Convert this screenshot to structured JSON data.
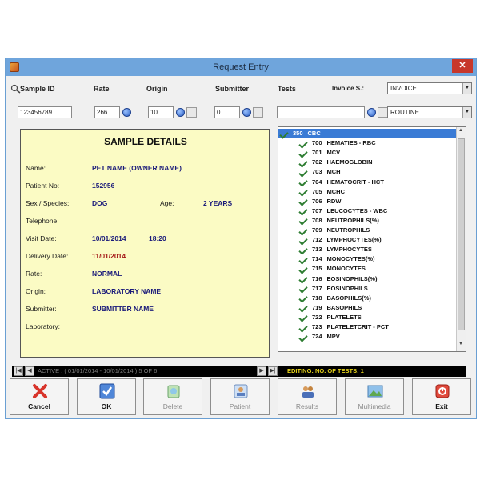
{
  "window": {
    "title": "Request Entry"
  },
  "header": {
    "sample_id_label": "Sample ID",
    "rate_label": "Rate",
    "origin_label": "Origin",
    "submitter_label": "Submitter",
    "tests_label": "Tests",
    "invoice_label": "Invoice S.:",
    "invoice_value": "INVOICE"
  },
  "inputs": {
    "sample_id": "123456789",
    "rate": "266",
    "origin": "10",
    "submitter": "0",
    "tests": "",
    "priority": "ROUTINE"
  },
  "details": {
    "heading": "SAMPLE DETAILS",
    "name_label": "Name:",
    "name": "PET NAME (OWNER NAME)",
    "patient_no_label": "Patient No:",
    "patient_no": "152956",
    "sex_species_label": "Sex / Species:",
    "sex_species": "DOG",
    "age_label": "Age:",
    "age": "2 YEARS",
    "telephone_label": "Telephone:",
    "visit_date_label": "Visit Date:",
    "visit_date": "10/01/2014",
    "visit_time": "18:20",
    "delivery_date_label": "Delivery Date:",
    "delivery_date": "11/01/2014",
    "rate_label": "Rate:",
    "rate": "NORMAL",
    "origin_label": "Origin:",
    "origin": "LABORATORY NAME",
    "submitter_label": "Submitter:",
    "submitter": "SUBMITTER NAME",
    "laboratory_label": "Laboratory:"
  },
  "tests": [
    {
      "code": "350",
      "name": "CBC",
      "selected": true
    },
    {
      "code": "700",
      "name": "HEMATIES - RBC"
    },
    {
      "code": "701",
      "name": "MCV"
    },
    {
      "code": "702",
      "name": "HAEMOGLOBIN"
    },
    {
      "code": "703",
      "name": "MCH"
    },
    {
      "code": "704",
      "name": "HEMATOCRIT - HCT"
    },
    {
      "code": "705",
      "name": "MCHC"
    },
    {
      "code": "706",
      "name": "RDW"
    },
    {
      "code": "707",
      "name": "LEUCOCYTES - WBC"
    },
    {
      "code": "708",
      "name": "NEUTROPHILS(%)"
    },
    {
      "code": "709",
      "name": "NEUTROPHILS"
    },
    {
      "code": "712",
      "name": "LYMPHOCYTES(%)"
    },
    {
      "code": "713",
      "name": "LYMPHOCYTES"
    },
    {
      "code": "714",
      "name": "MONOCYTES(%)"
    },
    {
      "code": "715",
      "name": "MONOCYTES"
    },
    {
      "code": "716",
      "name": "EOSINOPHILS(%)"
    },
    {
      "code": "717",
      "name": "EOSINOPHILS"
    },
    {
      "code": "718",
      "name": "BASOPHILS(%)"
    },
    {
      "code": "719",
      "name": "BASOPHILS"
    },
    {
      "code": "722",
      "name": "PLATELETS"
    },
    {
      "code": "723",
      "name": "PLATELETCRIT - PCT"
    },
    {
      "code": "724",
      "name": "MPV"
    }
  ],
  "status": {
    "active": "ACTIVE : ( 01/01/2014 - 10/01/2014 )  5  OF  6",
    "editing": "EDITING:   NO. OF TESTS:  1"
  },
  "toolbar": {
    "cancel": "Cancel",
    "ok": "OK",
    "delete": "Delete",
    "patient": "Patient",
    "results": "Results",
    "multimedia": "Multimedia",
    "exit": "Exit"
  },
  "colors": {
    "titlebar": "#6fa5dc",
    "details_bg": "#fbfbc4",
    "selected_row": "#3a7bd5",
    "status_bar": "#000000",
    "editing_text": "#e6d21a"
  }
}
